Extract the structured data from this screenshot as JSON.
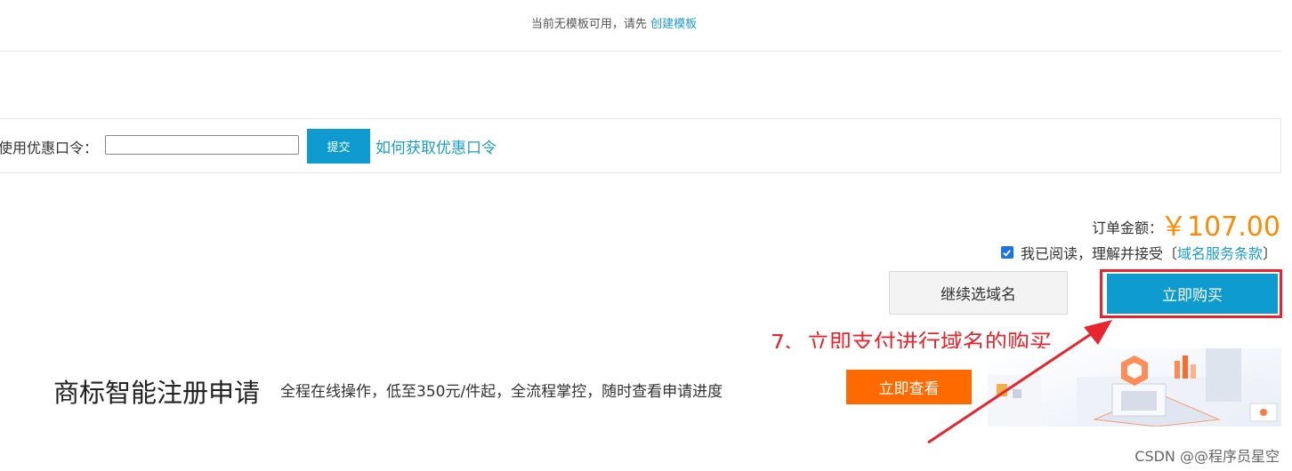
{
  "template_notice": {
    "text": "当前无模板可用，请先",
    "link": "创建模板"
  },
  "coupon": {
    "label": "使用优惠口令：",
    "input_value": "",
    "submit_label": "提交",
    "help_link": "如何获取优惠口令"
  },
  "order": {
    "total_label": "订单金额：",
    "total_amount": "￥107.00"
  },
  "agreement": {
    "checked": true,
    "text": "我已阅读，理解并接受",
    "bracket_open": "〔",
    "link": "域名服务条款",
    "bracket_close": "〕"
  },
  "buttons": {
    "continue_label": "继续选域名",
    "buy_now_label": "立即购买"
  },
  "annotation": {
    "text": "7、立即支付进行域名的购买",
    "color": "#e8242e"
  },
  "promo": {
    "title": "商标智能注册申请",
    "description": "全程在线操作，低至350元/件起，全流程掌控，随时查看申请进度",
    "button_label": "立即查看"
  },
  "watermark": "CSDN @@程序员星空",
  "colors": {
    "primary": "#0d9bd0",
    "link": "#1a9ec7",
    "price": "#ff8a00",
    "promo_button": "#ff6a00",
    "highlight": "#e8242e"
  }
}
